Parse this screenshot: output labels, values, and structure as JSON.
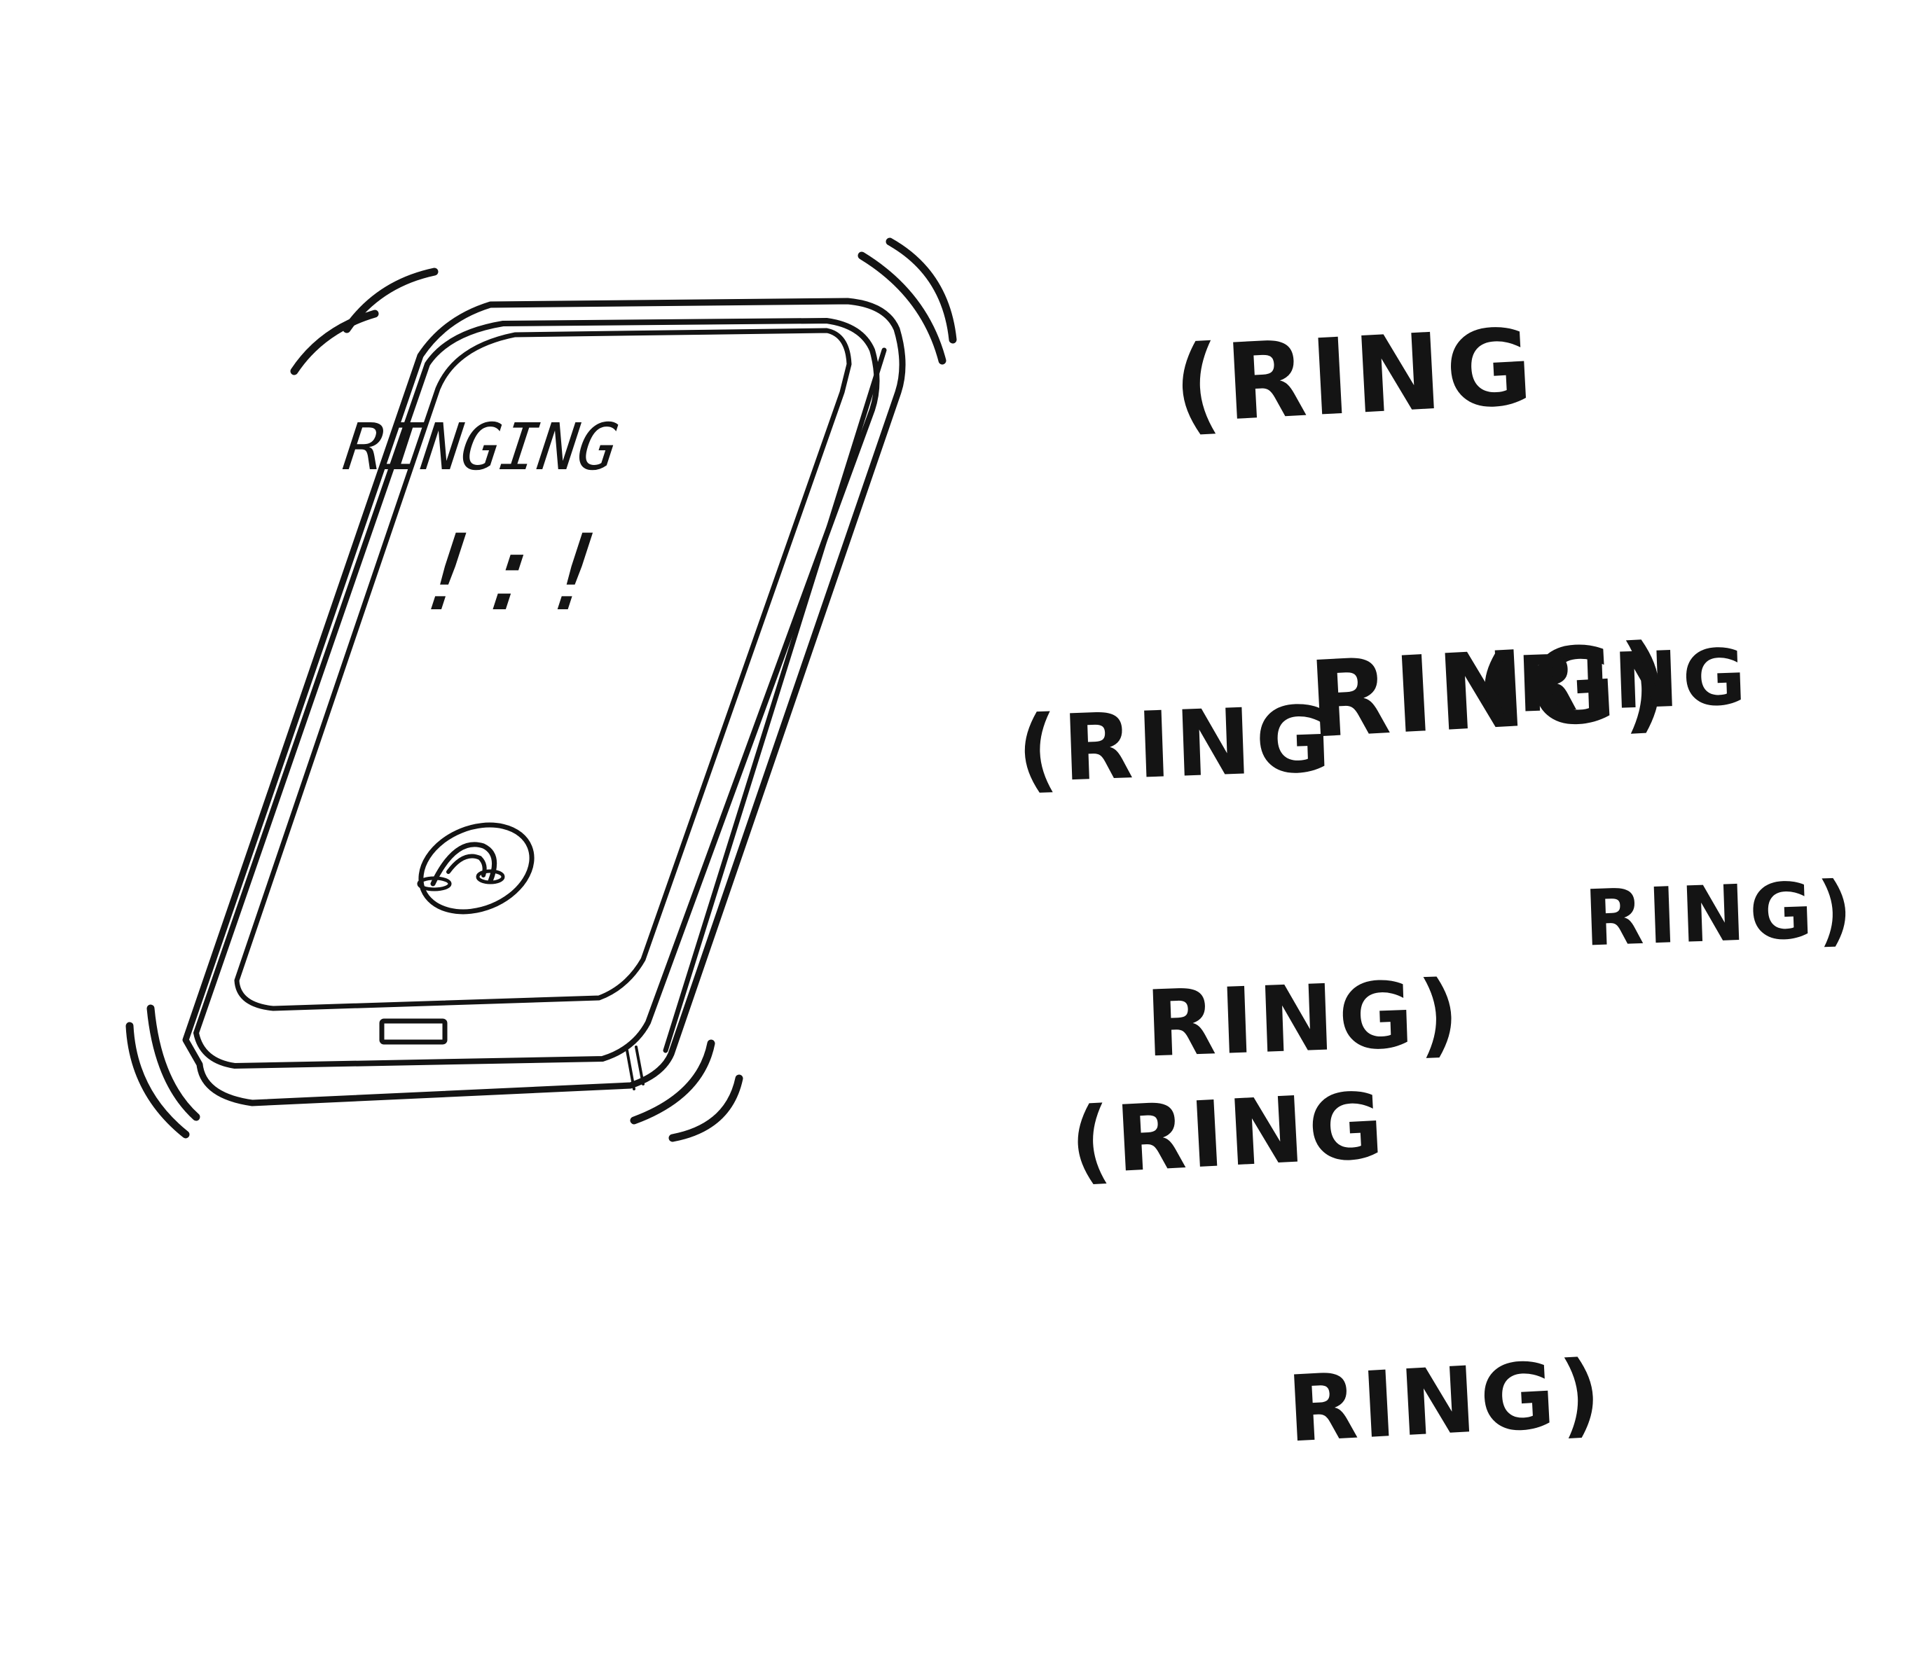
{
  "phone": {
    "screen_title": "RINGING",
    "screen_caller": "!:!",
    "call_button_icon": "phone-handset-icon"
  },
  "sound_effects": [
    {
      "line1": "(RING",
      "line2": "RING)"
    },
    {
      "line1": "(RING",
      "line2": "RING)"
    },
    {
      "line1": "(RING",
      "line2": "RING)"
    },
    {
      "line1": "(RING",
      "line2": "RING)"
    }
  ],
  "colors": {
    "ink": "#141414",
    "paper": "#ffffff"
  }
}
